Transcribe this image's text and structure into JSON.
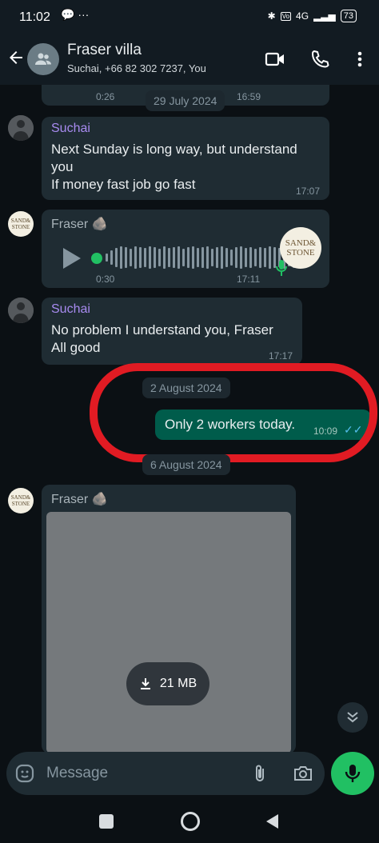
{
  "status_bar": {
    "time": "11:02",
    "network": "4G",
    "battery": "73"
  },
  "header": {
    "title": "Fraser villa",
    "subtitle": "Suchai, +66 82 302 7237, You"
  },
  "messages": {
    "top_partial": {
      "duration": "0:26",
      "time": "16:59"
    },
    "date_1": "29 July 2024",
    "m1": {
      "sender": "Suchai",
      "line1": "Next Sunday is long way, but understand",
      "line2": "you",
      "line3": "If money fast job go fast",
      "time": "17:07"
    },
    "m2": {
      "sender": "Fraser 🪨",
      "duration": "0:30",
      "time": "17:11",
      "logo_line1": "SAND&",
      "logo_line2": "STONE"
    },
    "m3": {
      "sender": "Suchai",
      "line1": "No problem I understand you, Fraser",
      "line2": "All good",
      "time": "17:17"
    },
    "date_2": "2 August 2024",
    "m4": {
      "text": "Only 2 workers today.",
      "time": "10:09",
      "ticks": "✓✓"
    },
    "date_3": "6 August 2024",
    "m5": {
      "sender": "Fraser 🪨",
      "size": "21 MB"
    }
  },
  "composer": {
    "placeholder": "Message"
  },
  "colors": {
    "accent": "#21c063",
    "outgoing": "#005c4b",
    "incoming": "#1f2c33",
    "annotation": "#e11b23"
  }
}
